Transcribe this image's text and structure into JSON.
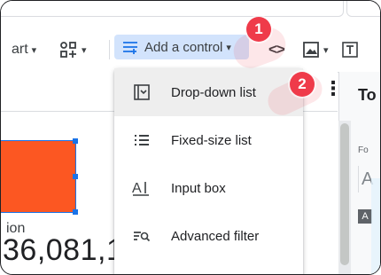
{
  "toolbar": {
    "chart_label": "art",
    "add_control_label": "Add a control",
    "code_label": "<>"
  },
  "subbar": {
    "more_icon": "⋮"
  },
  "right_panel": {
    "title": "To",
    "label": "Fo",
    "letter": "A",
    "chip": "A"
  },
  "canvas": {
    "chart_color": "#fc5722",
    "metric_label": "ion",
    "metric_value": "36,081,1"
  },
  "dropdown": {
    "items": [
      {
        "label": "Drop-down list",
        "icon": "dropdown-list-icon"
      },
      {
        "label": "Fixed-size list",
        "icon": "list-icon"
      },
      {
        "label": "Input box",
        "icon": "input-box-icon"
      },
      {
        "label": "Advanced filter",
        "icon": "advanced-filter-icon"
      }
    ]
  },
  "annotations": {
    "step1": "1",
    "step2": "2",
    "color": "#ef3b4a"
  }
}
